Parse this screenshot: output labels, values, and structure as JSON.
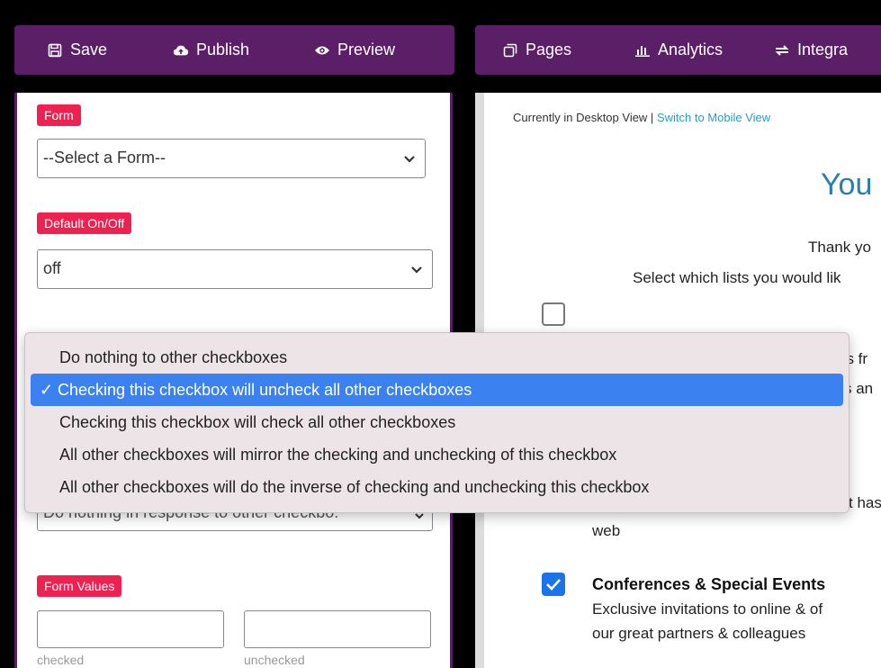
{
  "toolbar_left": {
    "save": "Save",
    "publish": "Publish",
    "preview": "Preview"
  },
  "toolbar_right": {
    "pages": "Pages",
    "analytics": "Analytics",
    "integrations": "Integra"
  },
  "settings": {
    "form_label": "Form",
    "form_select_value": "--Select a Form--",
    "default_label": "Default On/Off",
    "default_select_value": "off",
    "other_select_value": "Do nothing in response to other checkbo:",
    "form_values_label": "Form Values",
    "checked_caption": "checked",
    "unchecked_caption": "unchecked"
  },
  "dropdown": {
    "options": [
      "Do nothing to other checkboxes",
      "Checking this checkbox will uncheck all other checkboxes",
      "Checking this checkbox will check all other checkboxes",
      "All other checkboxes will mirror the checking and unchecking of this checkbox",
      "All other checkboxes will do the inverse of checking and unchecking this checkbox"
    ],
    "selected_index": 1,
    "check_mark": "✓"
  },
  "preview": {
    "view_status": "Currently in Desktop View | ",
    "switch_link": "Switch to Mobile View",
    "heading": "You",
    "thank_you": "Thank yo",
    "select_lists": "Select which lists you would lik",
    "frag_1": "es fr",
    "frag_2": "s an",
    "frag_3": "t has",
    "frag_web": "web",
    "item_title": "Conferences & Special Events",
    "item_desc_1": "Exclusive invitations to online & of",
    "item_desc_2": "our great partners & colleagues",
    "item_checked": true
  },
  "colors": {
    "toolbar_bg": "#5a1f66",
    "label_bg": "#ee2151",
    "selected_option": "#3b82f0",
    "heading_color": "#2a7fa8",
    "checkbox_blue": "#1a73e8"
  }
}
